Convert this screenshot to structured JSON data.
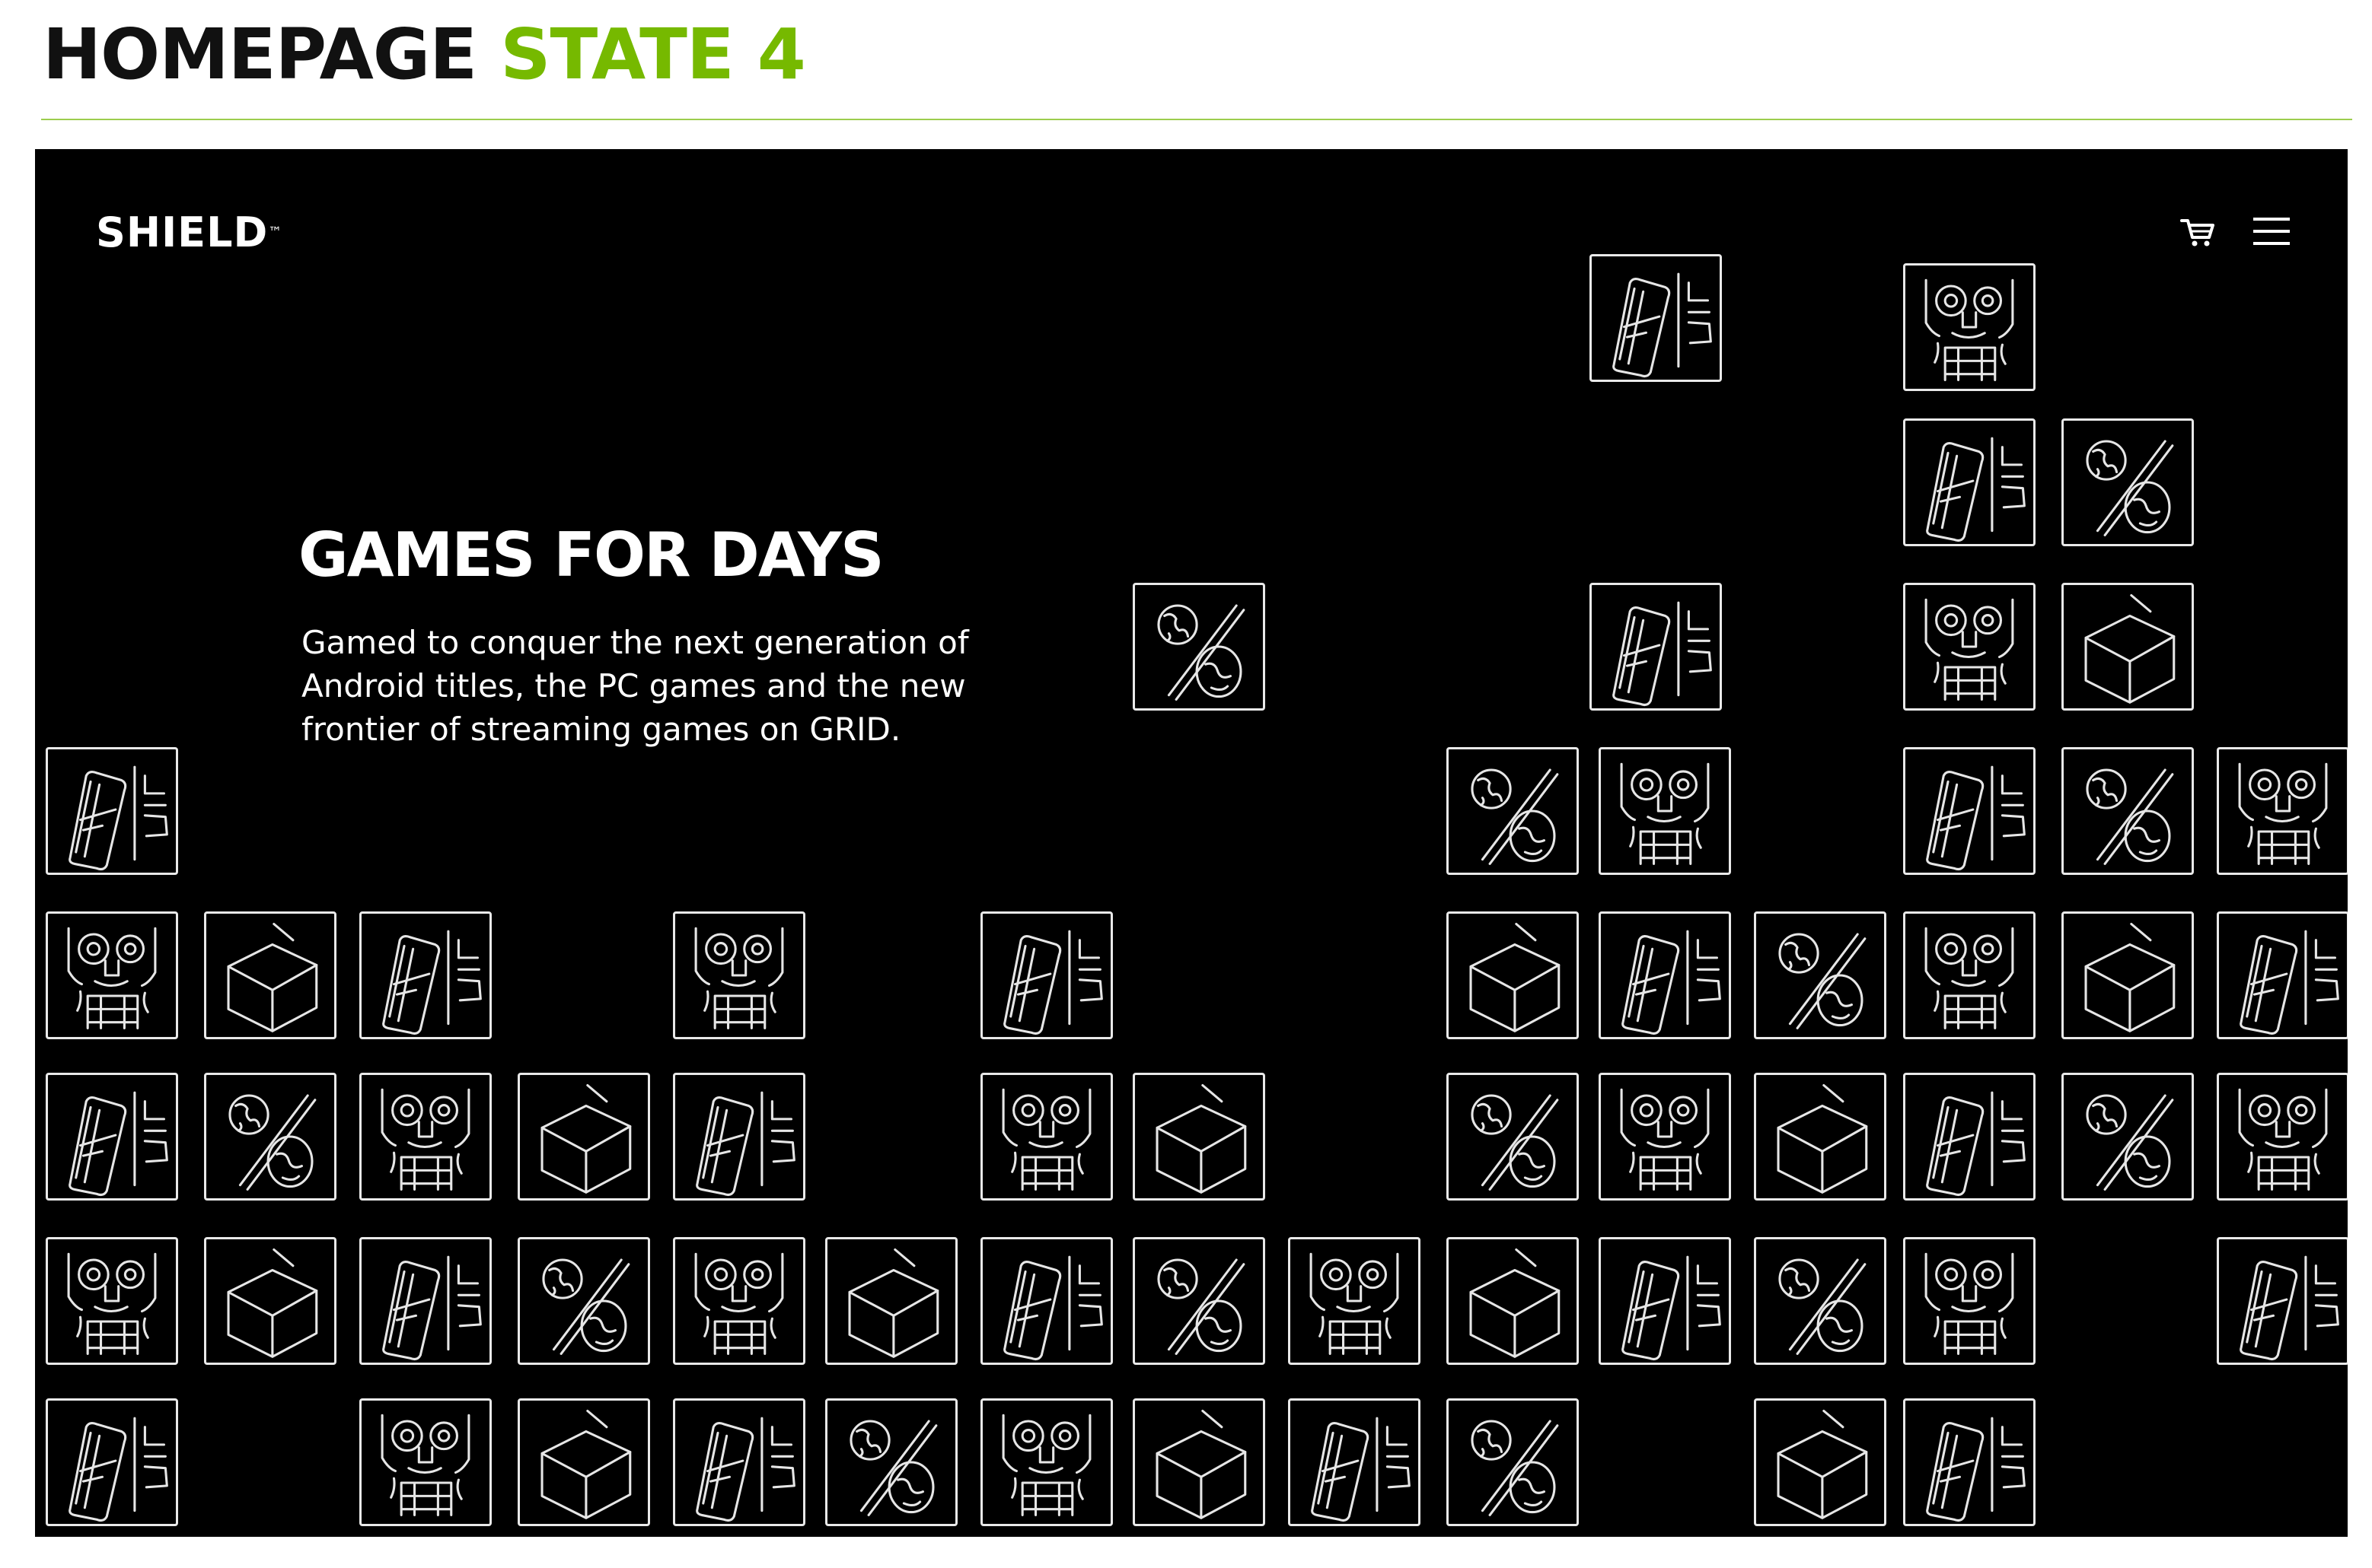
{
  "doc": {
    "title_main": "HOMEPAGE",
    "title_accent": "STATE 4",
    "accent_color": "#76b900"
  },
  "header": {
    "logo": "SHIELD",
    "logo_mark": "™",
    "icons": [
      "cart-icon",
      "hamburger-menu-icon"
    ]
  },
  "hero": {
    "headline": "GAMES FOR DAYS",
    "body": "Gamed to conquer the next generation of Android titles, the PC games and the new frontier of streaming games on GRID."
  },
  "tile_icons": [
    "phone-icon",
    "face-icon",
    "globe-percent-icon",
    "cube-icon"
  ]
}
